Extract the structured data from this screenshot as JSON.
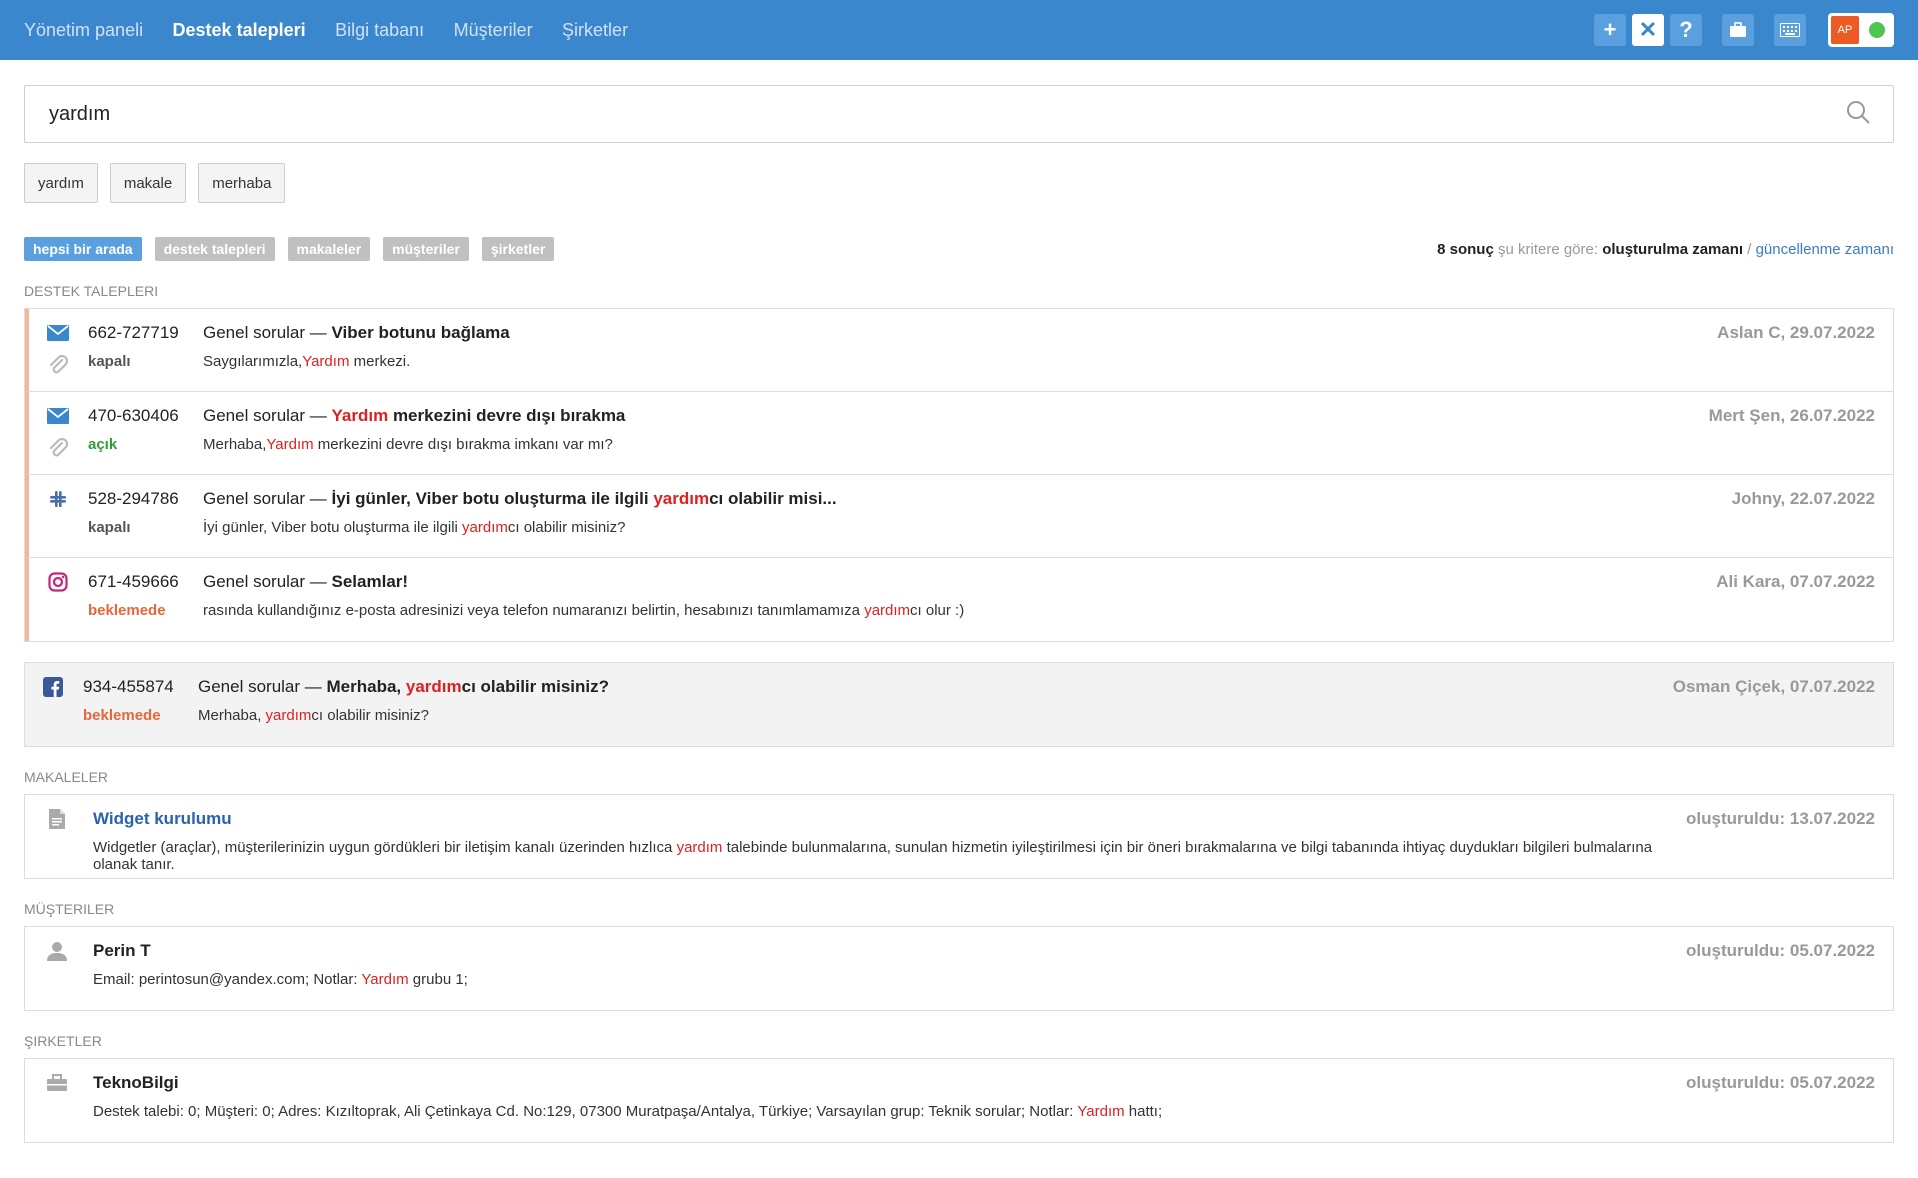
{
  "nav": {
    "items": [
      "Yönetim paneli",
      "Destek talepleri",
      "Bilgi tabanı",
      "Müşteriler",
      "Şirketler"
    ]
  },
  "topbar": {
    "avatar_initials": "AP",
    "icons": [
      "plus-icon",
      "close-icon",
      "question-icon",
      "briefcase-icon",
      "keyboard-icon"
    ]
  },
  "search": {
    "value": "yardım",
    "placeholder": ""
  },
  "chips": [
    "yardım",
    "makale",
    "merhaba"
  ],
  "filters": {
    "tabs": [
      "hepsi bir arada",
      "destek talepleri",
      "makaleler",
      "müşteriler",
      "şirketler"
    ],
    "active": 0
  },
  "results": {
    "count": "8 sonuç",
    "criteria_label": "şu kritere göre:",
    "sort_active": "oluşturulma zamanı",
    "sort_sep": "/",
    "sort_other": "güncellenme zamanı"
  },
  "sections": {
    "tickets": "DESTEK TALEPLERI",
    "articles": "MAKALELER",
    "customers": "MÜŞTERILER",
    "companies": "ŞIRKETLER"
  },
  "tickets": [
    {
      "channel_icon": "envelope-icon",
      "attachment": true,
      "id": "662-727719",
      "status": "kapalı",
      "status_type": "closed",
      "category": "Genel sorular —",
      "title_parts": [
        "Viber botunu bağlama"
      ],
      "snippet_parts": [
        "Saygılarımızla,",
        "Yardım",
        " merkezi."
      ],
      "meta": "Aslan C, 29.07.2022"
    },
    {
      "channel_icon": "envelope-icon",
      "attachment": true,
      "id": "470-630406",
      "status": "açık",
      "status_type": "open",
      "category": "Genel sorular —",
      "title_parts": [
        "",
        "Yardım",
        " merkezini devre dışı bırakma"
      ],
      "snippet_parts": [
        "Merhaba,",
        "Yardım",
        " merkezini devre dışı bırakma imkanı var mı?"
      ],
      "meta": "Mert Şen, 26.07.2022"
    },
    {
      "channel_icon": "slack-icon",
      "attachment": false,
      "id": "528-294786",
      "status": "kapalı",
      "status_type": "closed",
      "category": "Genel sorular —",
      "title_parts": [
        "İyi günler, Viber botu oluşturma ile ilgili ",
        "yardım",
        "cı olabilir misi..."
      ],
      "snippet_parts": [
        "İyi günler, Viber botu oluşturma ile ilgili ",
        "yardım",
        "cı olabilir misiniz?"
      ],
      "meta": "Johny, 22.07.2022"
    },
    {
      "channel_icon": "instagram-icon",
      "attachment": false,
      "id": "671-459666",
      "status": "beklemede",
      "status_type": "pending",
      "category": "Genel sorular —",
      "title_parts": [
        "Selamlar!"
      ],
      "snippet_parts": [
        "rasında kullandığınız e-posta adresinizi veya telefon numaranızı belirtin, hesabınızı tanımlamamıza ",
        "yardım",
        "cı olur :)"
      ],
      "meta": "Ali Kara, 07.07.2022"
    }
  ],
  "ticket_single": {
    "channel_icon": "facebook-icon",
    "attachment": false,
    "id": "934-455874",
    "status": "beklemede",
    "status_type": "pending",
    "category": "Genel sorular —",
    "title_parts": [
      "Merhaba, ",
      "yardım",
      "cı olabilir misiniz?"
    ],
    "snippet_parts": [
      "Merhaba, ",
      "yardım",
      "cı olabilir misiniz?"
    ],
    "meta": "Osman Çiçek, 07.07.2022"
  },
  "article": {
    "icon": "document-icon",
    "title": "Widget kurulumu",
    "text_parts": [
      "Widgetler (araçlar), müşterilerinizin uygun gördükleri bir iletişim kanalı üzerinden hızlıca ",
      "yardım",
      " talebinde bulunmalarına, sunulan hizmetin iyileştirilmesi için bir öneri bırakmalarına ve bilgi tabanında ihtiyaç duydukları bilgileri bulmalarına olanak tanır."
    ],
    "meta": "oluşturuldu: 13.07.2022"
  },
  "customer": {
    "icon": "user-icon",
    "title": "Perin T",
    "text_parts": [
      "Email: perintosun@yandex.com; Notlar: ",
      "Yardım",
      " grubu 1;"
    ],
    "meta": "oluşturuldu: 05.07.2022"
  },
  "company": {
    "icon": "briefcase-icon",
    "title": "TeknoBilgi",
    "text_parts": [
      "Destek talebi: 0; Müşteri: 0; Adres: Kızıltoprak, Ali Çetinkaya Cd. No:129, 07300 Muratpaşa/Antalya, Türkiye; Varsayılan grup: Teknik sorular; Notlar: ",
      "Yardım",
      " hattı;"
    ],
    "meta": "oluşturuldu: 05.07.2022"
  }
}
